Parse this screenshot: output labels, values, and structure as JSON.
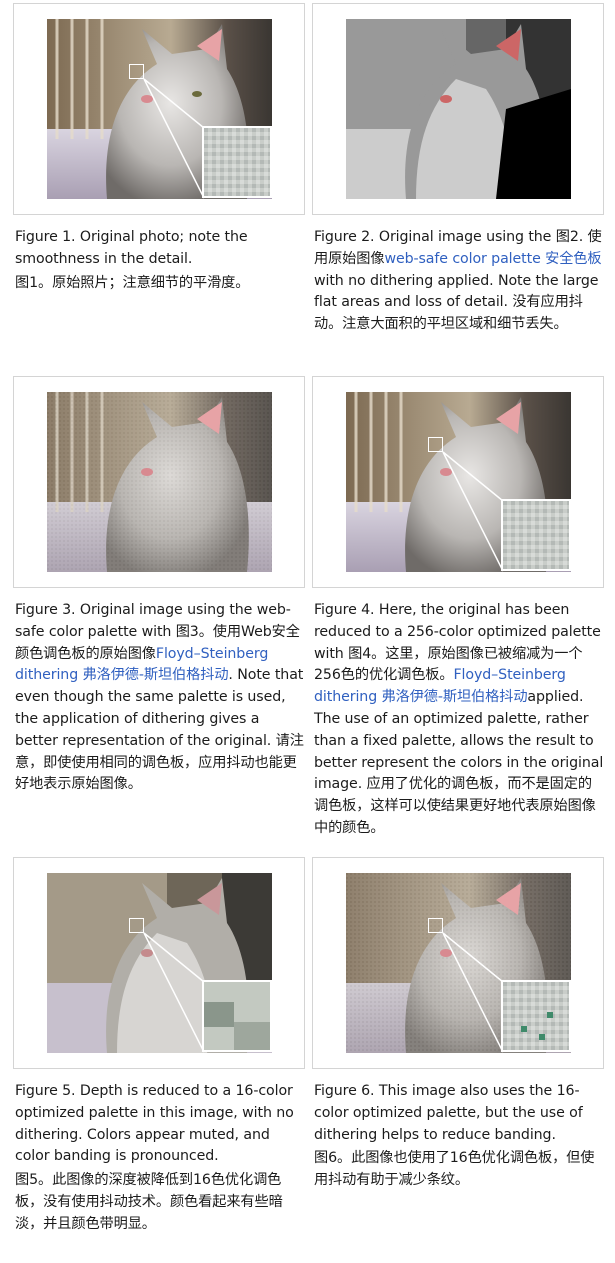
{
  "colors": {
    "link": "#3060c0",
    "border": "#d4d4d4",
    "text": "#1b1b1b"
  },
  "figures": [
    {
      "image_alt": "cat-photo-original",
      "has_zoom_inset": true,
      "cap1": "Figure 1. Original photo; note the smoothness in the detail.",
      "cap2": "图1。原始照片；注意细节的平滑度。"
    },
    {
      "image_alt": "cat-photo-web-safe-no-dither",
      "has_zoom_inset": true,
      "pre": "Figure 2. Original image using the 图2. 使用原始图像",
      "link": "web-safe color palette 安全色板",
      "post": "with no dithering applied. Note the large flat areas and loss of detail. 没有应用抖动。注意大面积的平坦区域和细节丢失。"
    },
    {
      "image_alt": "cat-photo-web-safe-floyd-steinberg",
      "has_zoom_inset": false,
      "pre": "Figure 3. Original image using the web-safe color palette with 图3。使用Web安全颜色调色板的原始图像",
      "link": "Floyd–Steinberg dithering 弗洛伊德-斯坦伯格抖动",
      "post": ". Note that even though the same palette is used, the application of dithering gives a better representation of the original. 请注意，即使使用相同的调色板，应用抖动也能更好地表示原始图像。"
    },
    {
      "image_alt": "cat-photo-256-color-dither",
      "has_zoom_inset": true,
      "pre": "Figure 4. Here, the original has been reduced to a 256-color optimized palette with 图4。这里，原始图像已被缩减为一个256色的优化调色板。",
      "link": "Floyd–Steinberg dithering 弗洛伊德-斯坦伯格抖动",
      "post": "applied. The use of an optimized palette, rather than a fixed palette, allows the result to better represent the colors in the original image. 应用了优化的调色板，而不是固定的调色板，这样可以使结果更好地代表原始图像中的颜色。"
    },
    {
      "image_alt": "cat-photo-16-color-no-dither",
      "has_zoom_inset": true,
      "cap1": "Figure 5. Depth is reduced to a 16-color optimized palette in this image, with no dithering. Colors appear muted, and color banding is pronounced.",
      "cap2": "图5。此图像的深度被降低到16色优化调色板，没有使用抖动技术。颜色看起来有些暗淡，并且颜色带明显。"
    },
    {
      "image_alt": "cat-photo-16-color-dither",
      "has_zoom_inset": true,
      "cap1": "Figure 6. This image also uses the 16-color optimized palette, but the use of dithering helps to reduce banding.",
      "cap2": "图6。此图像也使用了16色优化调色板，但使用抖动有助于减少条纹。"
    }
  ]
}
